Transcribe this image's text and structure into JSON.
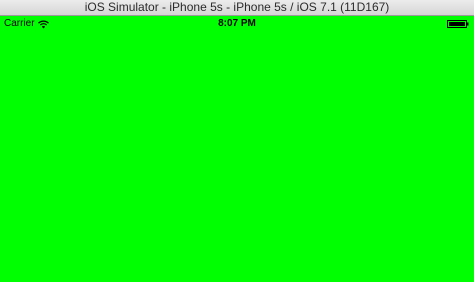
{
  "window": {
    "title": "iOS Simulator - iPhone 5s - iPhone 5s / iOS 7.1 (11D167)"
  },
  "status_bar": {
    "carrier": "Carrier",
    "wifi_icon": "wifi-icon",
    "time": "8:07 PM",
    "battery_icon": "battery-icon",
    "battery_level": 1.0
  },
  "screen": {
    "background_color": "#00ff00"
  }
}
